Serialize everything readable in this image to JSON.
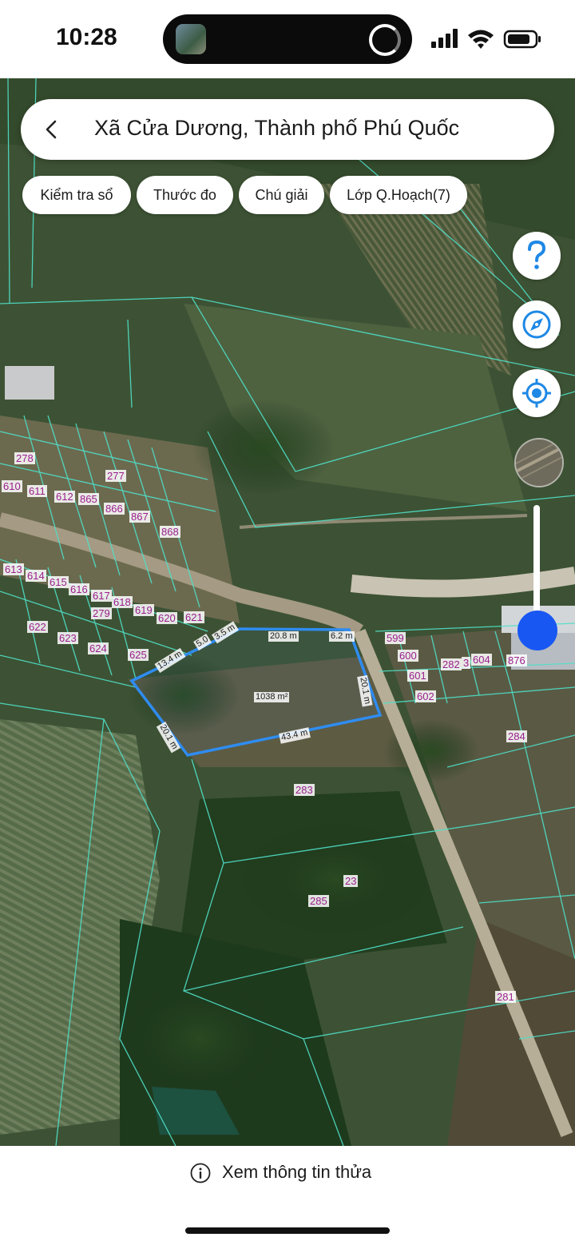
{
  "status_bar": {
    "time": "10:28"
  },
  "search": {
    "title": "Xã Cửa Dương, Thành phố Phú Quốc"
  },
  "chips": [
    {
      "label": "Kiểm tra sổ"
    },
    {
      "label": "Thước đo"
    },
    {
      "label": "Chú giải"
    },
    {
      "label": "Lớp Q.Hoạch(7)"
    }
  ],
  "controls": {
    "help_icon": "question-icon",
    "compass_icon": "compass-icon",
    "locate_icon": "crosshair-icon",
    "layer_opacity_percent": 12
  },
  "map": {
    "selected_parcel": {
      "area": "1038 m²",
      "edges": [
        "20.8 m",
        "6.2 m",
        "20.1 m",
        "43.4 m",
        "20.1 m",
        "13.4 m",
        "5.0",
        "3.5 m"
      ],
      "outline_color": "#2f8cf0"
    },
    "plot_numbers": [
      "278",
      "610",
      "611",
      "612",
      "865",
      "277",
      "866",
      "867",
      "868",
      "613",
      "614",
      "615",
      "616",
      "617",
      "618",
      "619",
      "620",
      "621",
      "279",
      "622",
      "623",
      "624",
      "625",
      "599",
      "600",
      "601",
      "602",
      "282",
      "3",
      "604",
      "876",
      "284",
      "283",
      "23",
      "285",
      "281"
    ],
    "boundary_color": "#4fe0c8"
  },
  "footer": {
    "info_label": "Xem thông tin thửa"
  }
}
